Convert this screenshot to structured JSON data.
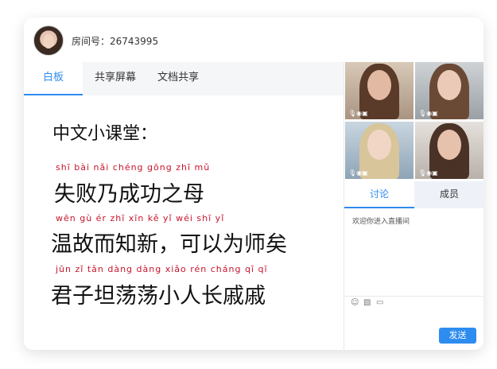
{
  "header": {
    "room_label": "房间号：26743995"
  },
  "tabs": [
    {
      "label": "白板"
    },
    {
      "label": "共享屏幕"
    },
    {
      "label": "文档共享"
    }
  ],
  "board": {
    "title": "中文小课堂：",
    "lines": [
      {
        "pinyin": "shī  bài  nǎi chéng gōng zhī mǔ",
        "text": "失败乃成功之母"
      },
      {
        "pinyin": "wēn  gù   ér  zhī  xīn   kě  yǐ  wéi  shī  yǐ",
        "text": "温故而知新，可以为师矣"
      },
      {
        "pinyin": "jūn  zǐ  tǎn dàng dàng xiǎo rén cháng qī  qī",
        "text": "君子坦荡荡小人长戚戚"
      }
    ]
  },
  "chat": {
    "tabs": [
      {
        "label": "讨论"
      },
      {
        "label": "成员"
      }
    ],
    "welcome": "欢迎你进入直播间",
    "send_label": "发送"
  },
  "icons": {
    "emoji": "emoji-icon",
    "image": "image-icon",
    "folder": "folder-icon"
  },
  "colors": {
    "accent": "#2d8cf0",
    "pinyin": "#c8142c"
  }
}
